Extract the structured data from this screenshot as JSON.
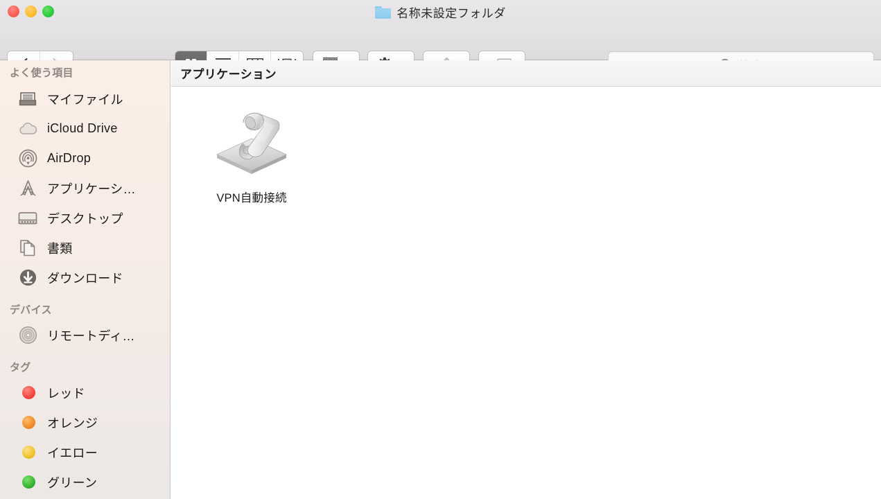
{
  "window": {
    "title": "名称未設定フォルダ",
    "title_icon": "blue-folder-icon",
    "traffic_lights": [
      {
        "name": "close",
        "color": "#fb5f55"
      },
      {
        "name": "minimize",
        "color": "#fdbd2e"
      },
      {
        "name": "zoom",
        "color": "#2bcc3f"
      }
    ]
  },
  "toolbar": {
    "nav": {
      "back_icon": "chevron-left-icon",
      "forward_icon": "chevron-right-icon",
      "back_enabled": true,
      "forward_enabled": false
    },
    "view_modes": [
      {
        "id": "icon",
        "icon": "icon-view-icon",
        "selected": true
      },
      {
        "id": "list",
        "icon": "list-view-icon",
        "selected": false
      },
      {
        "id": "column",
        "icon": "column-view-icon",
        "selected": false
      },
      {
        "id": "gallery",
        "icon": "cover-flow-view-icon",
        "selected": false
      }
    ],
    "arrange": {
      "icon": "arrange-by-icon",
      "chevron": "chevron-down-icon"
    },
    "action": {
      "icon": "gear-icon",
      "chevron": "chevron-down-icon"
    },
    "share": {
      "icon": "share-icon",
      "enabled": false
    },
    "tags": {
      "icon": "tag-icon"
    }
  },
  "search": {
    "placeholder": "検索",
    "value": "",
    "icon": "search-icon"
  },
  "sidebar": {
    "sections": [
      {
        "title": "よく使う項目",
        "items": [
          {
            "label": "マイファイル",
            "icon": "all-my-files-icon"
          },
          {
            "label": "iCloud Drive",
            "icon": "icloud-icon"
          },
          {
            "label": "AirDrop",
            "icon": "airdrop-icon"
          },
          {
            "label": "アプリケーシ…",
            "icon": "applications-icon"
          },
          {
            "label": "デスクトップ",
            "icon": "desktop-icon"
          },
          {
            "label": "書類",
            "icon": "documents-icon"
          },
          {
            "label": "ダウンロード",
            "icon": "downloads-icon"
          }
        ]
      },
      {
        "title": "デバイス",
        "items": [
          {
            "label": "リモートディ…",
            "icon": "remote-disc-icon"
          }
        ]
      },
      {
        "title": "タグ",
        "items": [
          {
            "label": "レッド",
            "icon": "tag-dot",
            "color": "#f44b46"
          },
          {
            "label": "オレンジ",
            "icon": "tag-dot",
            "color": "#ef8a28"
          },
          {
            "label": "イエロー",
            "icon": "tag-dot",
            "color": "#eec12a"
          },
          {
            "label": "グリーン",
            "icon": "tag-dot",
            "color": "#34b233"
          }
        ]
      }
    ]
  },
  "content": {
    "group_header": "アプリケーション",
    "files": [
      {
        "name": "VPN自動接続",
        "icon": "applescript-script-icon",
        "selected": false
      }
    ]
  }
}
